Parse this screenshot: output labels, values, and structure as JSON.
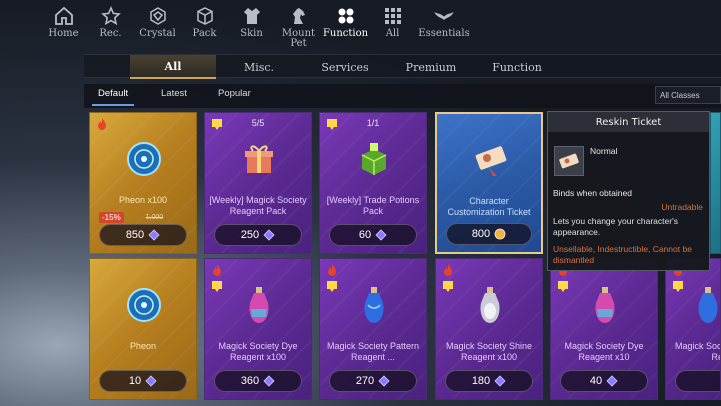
{
  "nav": {
    "items": [
      {
        "label": "Home",
        "icon": "home-icon"
      },
      {
        "label": "Rec.",
        "icon": "star-icon"
      },
      {
        "label": "Crystal",
        "icon": "crystal-icon"
      },
      {
        "label": "Pack",
        "icon": "pack-icon"
      },
      {
        "label": "Skin",
        "icon": "skin-icon"
      },
      {
        "label": "Mount\nPet",
        "icon": "mount-icon"
      },
      {
        "label": "Function",
        "icon": "function-icon",
        "active": true
      },
      {
        "label": "All",
        "icon": "grid-icon"
      },
      {
        "label": "Essentials",
        "icon": "wings-icon"
      }
    ]
  },
  "category_tabs": [
    "All",
    "Misc.",
    "Services",
    "Premium",
    "Function"
  ],
  "sort": {
    "default": "Default",
    "latest": "Latest",
    "popular": "Popular",
    "class_filter": "All Classes"
  },
  "cards_row1": [
    {
      "name": "Pheon x100",
      "price": "850",
      "discount": "-15%",
      "old_price": "1,000",
      "style": "gold",
      "limit": ""
    },
    {
      "name": "[Weekly] Magick Society Reagent Pack",
      "price": "250",
      "limit": "5/5",
      "style": "purple"
    },
    {
      "name": "[Weekly] Trade Potions Pack",
      "price": "60",
      "limit": "1/1",
      "style": "purple"
    },
    {
      "name": "Character Customization Ticket",
      "price": "800",
      "limit": "",
      "style": "blue"
    }
  ],
  "cards_row2": [
    {
      "name": "Pheon",
      "price": "10",
      "style": "gold"
    },
    {
      "name": "Magick Society Dye Reagent x100",
      "price": "360",
      "style": "purple"
    },
    {
      "name": "Magick Society Pattern Reagent ...",
      "price": "270",
      "style": "purple"
    },
    {
      "name": "Magick Society Shine Reagent x100",
      "price": "180",
      "style": "purple"
    },
    {
      "name": "Magick Society Dye Reagent x10",
      "price": "40",
      "style": "purple"
    },
    {
      "name": "Magick Society Pattern Re...",
      "price": "",
      "style": "purple"
    }
  ],
  "tooltip": {
    "title": "Reskin Ticket",
    "grade": "Normal",
    "bind": "Binds when obtained",
    "untradable": "Untradable",
    "description": "Lets you change your character's appearance.",
    "flags": "Unsellable, Indestructible, Cannot be dismantled"
  },
  "colors": {
    "gold_card": "#c99028",
    "purple_card": "#6a31a6",
    "blue_card": "#2b5aa6",
    "accent_orange": "#d8743a",
    "active_tab_underline": "#c9a85a"
  }
}
